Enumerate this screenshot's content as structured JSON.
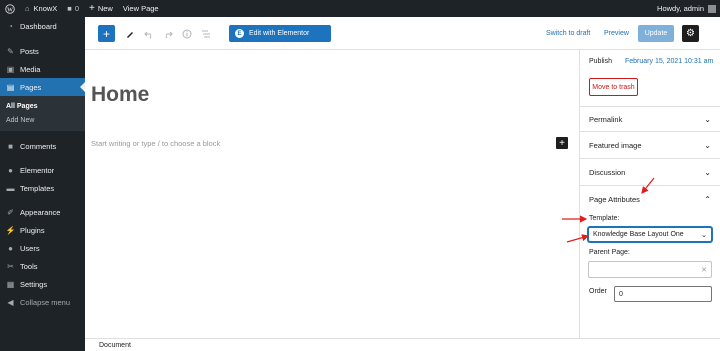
{
  "adminbar": {
    "site_name": "KnowX",
    "comments_count": "0",
    "new_label": "New",
    "view_page_label": "View Page",
    "greeting": "Howdy, admin"
  },
  "sidebar": {
    "dashboard": "Dashboard",
    "posts": "Posts",
    "media": "Media",
    "pages": "Pages",
    "pages_sub": {
      "all_pages": "All Pages",
      "add_new": "Add New"
    },
    "comments": "Comments",
    "elementor": "Elementor",
    "templates": "Templates",
    "appearance": "Appearance",
    "plugins": "Plugins",
    "users": "Users",
    "tools": "Tools",
    "settings": "Settings",
    "collapse": "Collapse menu"
  },
  "toolbar": {
    "add_block_icon": "plus-icon",
    "edit_elementor_label": "Edit with Elementor",
    "switch_to_draft_label": "Switch to draft",
    "preview_label": "Preview",
    "update_label": "Update",
    "settings_icon": "gear-icon"
  },
  "content": {
    "title": "Home",
    "block_placeholder": "Start writing or type / to choose a block"
  },
  "settings_panel": {
    "publish_label": "Publish",
    "publish_date": "February 15, 2021 10:31 am",
    "move_to_trash_label": "Move to trash",
    "permalink_label": "Permalink",
    "featured_image_label": "Featured image",
    "discussion_label": "Discussion",
    "page_attributes_label": "Page Attributes",
    "template_label": "Template:",
    "template_value": "Knowledge Base Layout One",
    "parent_page_label": "Parent Page:",
    "parent_page_value": "",
    "order_label": "Order",
    "order_value": "0"
  },
  "footer": {
    "breadcrumb": "Document"
  },
  "colors": {
    "admin_dark": "#1d2327",
    "accent": "#2271b1",
    "elementor_blue": "#1e73be",
    "trash_red": "#cc1818",
    "annotation_red": "#e01e1e"
  }
}
